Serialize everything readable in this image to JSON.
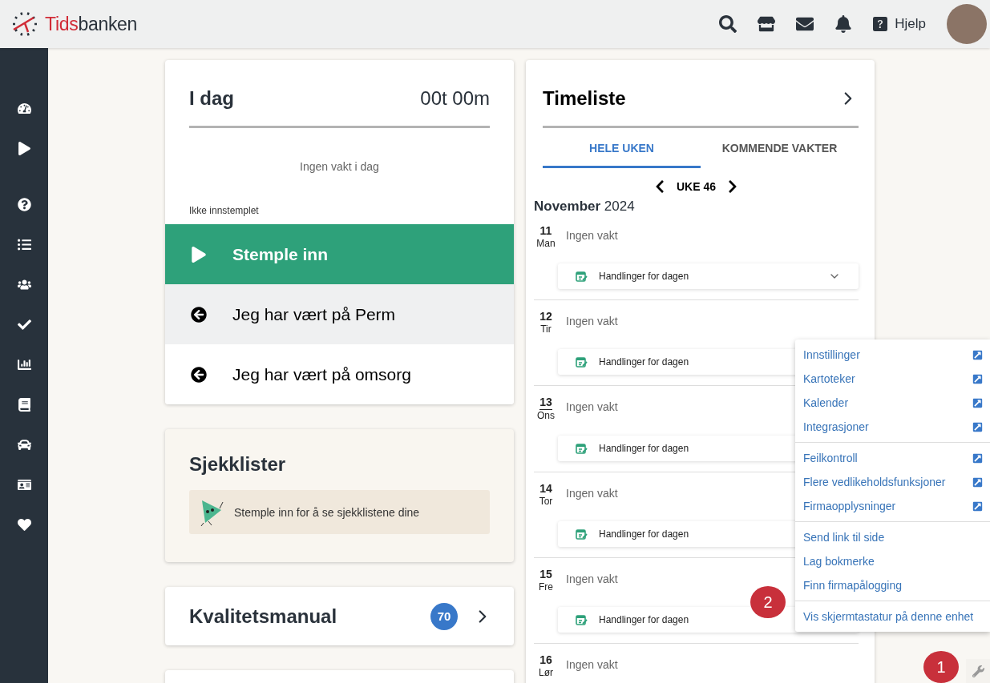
{
  "header": {
    "logo": {
      "accent": "Tids",
      "rest": "banken"
    },
    "help_label": "Hjelp"
  },
  "today_card": {
    "title": "I dag",
    "duration": "00t 00m",
    "message": "Ingen vakt i dag",
    "status": "Ikke innstemplet",
    "actions": [
      {
        "label": "Stemple inn",
        "kind": "primary"
      },
      {
        "label": "Jeg har vært på Perm",
        "kind": "back",
        "highlighted": true
      },
      {
        "label": "Jeg har vært på omsorg",
        "kind": "back",
        "highlighted": false
      }
    ]
  },
  "checklist_card": {
    "title": "Sjekklister",
    "message": "Stemple inn for å se sjekklistene dine"
  },
  "quality_card": {
    "title": "Kvalitetsmanual",
    "count": "70"
  },
  "timesheet": {
    "title": "Timeliste",
    "tabs": [
      {
        "label": "HELE UKEN",
        "selected": true
      },
      {
        "label": "KOMMENDE VAKTER",
        "selected": false
      }
    ],
    "week": "UKE 46",
    "month": "**November** 2024",
    "days": [
      {
        "date": "11",
        "weekday": "Man",
        "status": "Ingen vakt",
        "action": "Handlinger for dagen",
        "today": false
      },
      {
        "date": "12",
        "weekday": "Tir",
        "status": "Ingen vakt",
        "action": "Handlinger for dagen",
        "today": false
      },
      {
        "date": "13",
        "weekday": "Ons",
        "status": "Ingen vakt",
        "action": "Handlinger for dagen",
        "today": true
      },
      {
        "date": "14",
        "weekday": "Tor",
        "status": "Ingen vakt",
        "action": "Handlinger for dagen",
        "today": false
      },
      {
        "date": "15",
        "weekday": "Fre",
        "status": "Ingen vakt",
        "action": "Handlinger for dagen",
        "today": false
      },
      {
        "date": "16",
        "weekday": "Lør",
        "status": "Ingen vakt",
        "today": false
      }
    ]
  },
  "tools_menu": {
    "groups": [
      [
        {
          "label": "Innstillinger",
          "external": true
        },
        {
          "label": "Kartoteker",
          "external": true
        },
        {
          "label": "Kalender",
          "external": true
        },
        {
          "label": "Integrasjoner",
          "external": true
        }
      ],
      [
        {
          "label": "Feilkontroll",
          "external": true
        },
        {
          "label": "Flere vedlikeholdsfunksjoner",
          "external": true
        },
        {
          "label": "Firmaopplysninger",
          "external": true
        }
      ],
      [
        {
          "label": "Send link til side",
          "external": false
        },
        {
          "label": "Lag bokmerke",
          "external": false
        },
        {
          "label": "Finn firmapålogging",
          "external": false
        }
      ],
      [
        {
          "label": "Vis skjermtastatur på denne enhet",
          "external": false
        }
      ]
    ]
  },
  "callouts": [
    {
      "number": "1"
    },
    {
      "number": "2"
    }
  ]
}
